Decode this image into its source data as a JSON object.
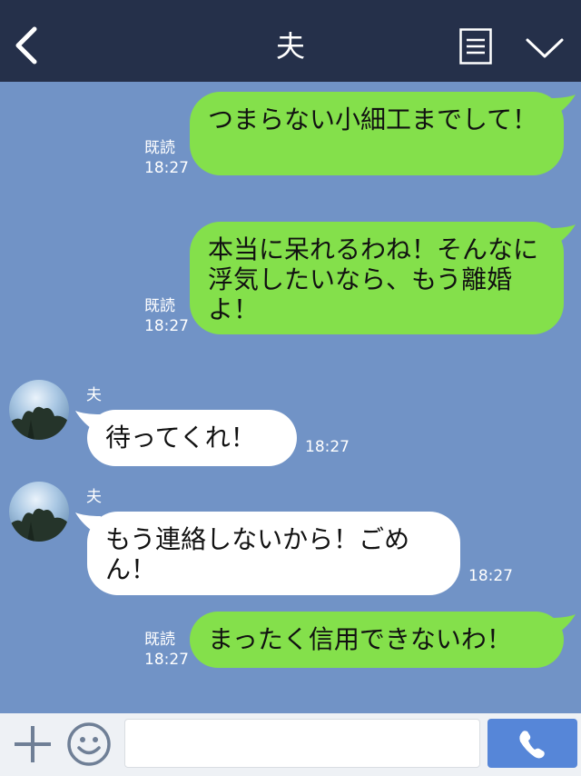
{
  "header": {
    "title": "夫"
  },
  "messages": [
    {
      "dir": "out",
      "text": "つまらない小細工までして！",
      "read": "既読",
      "time": "18:27"
    },
    {
      "dir": "out",
      "text": "本当に呆れるわね！そんなに浮気したいなら、もう離婚よ！",
      "read": "既読",
      "time": "18:27"
    },
    {
      "dir": "in",
      "sender": "夫",
      "text": "待ってくれ！",
      "time": "18:27"
    },
    {
      "dir": "in",
      "sender": "夫",
      "text": "もう連絡しないから！ごめん！",
      "time": "18:27"
    },
    {
      "dir": "out",
      "text": "まったく信用できないわ！",
      "read": "既読",
      "time": "18:27"
    }
  ],
  "input": {
    "placeholder": ""
  },
  "colors": {
    "header_bg": "#25304a",
    "chat_bg": "#7193c6",
    "outgoing_bubble": "#84e04b",
    "incoming_bubble": "#ffffff",
    "send_button": "#5686d8"
  },
  "icons": [
    "back-arrow-icon",
    "menu-icon",
    "chevron-down-icon",
    "plus-icon",
    "emoji-icon",
    "phone-icon"
  ]
}
